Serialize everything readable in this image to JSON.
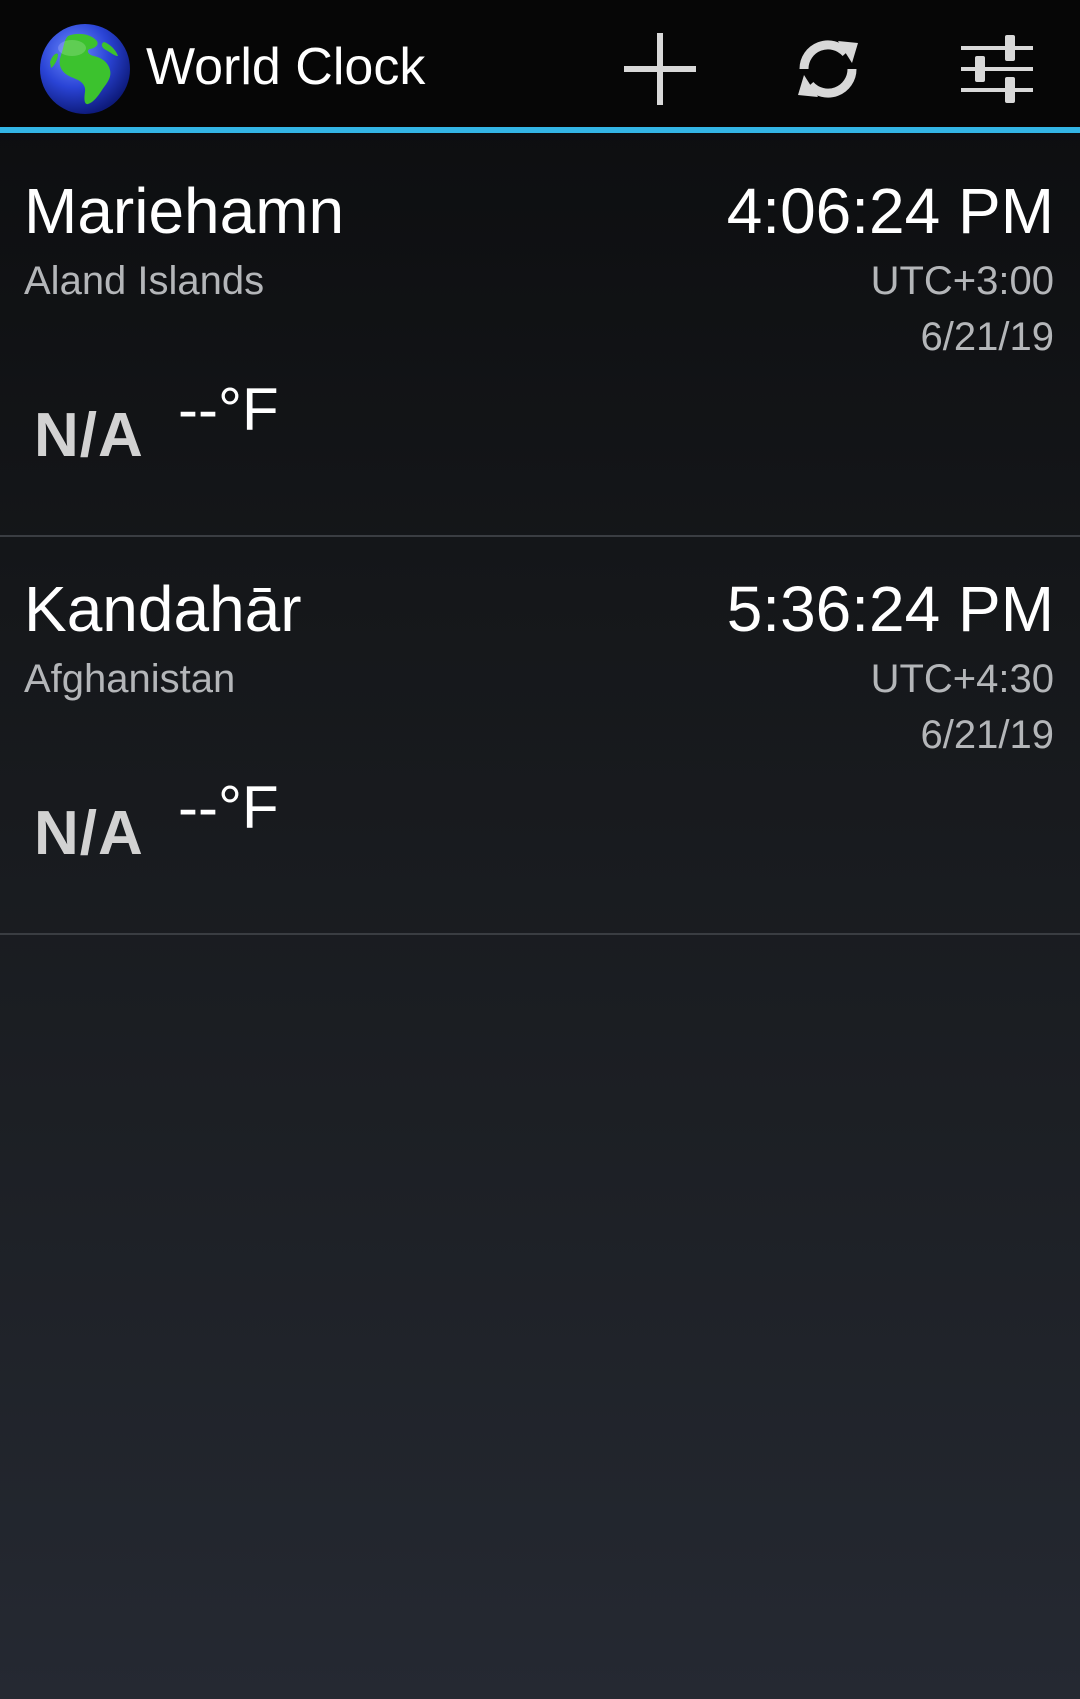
{
  "action_bar": {
    "title": "World Clock",
    "icons": {
      "app": "globe-icon",
      "add": "plus-icon",
      "refresh": "refresh-icon",
      "settings": "sliders-icon"
    },
    "accent_color": "#33b5e5"
  },
  "clocks": [
    {
      "city": "Mariehamn",
      "country": "Aland Islands",
      "time": "4:06:24 PM",
      "utc_offset": "UTC+3:00",
      "date": "6/21/19",
      "weather_icon_text": "N/A",
      "temperature": "--°F"
    },
    {
      "city": "Kandahār",
      "country": "Afghanistan",
      "time": "5:36:24 PM",
      "utc_offset": "UTC+4:30",
      "date": "6/21/19",
      "weather_icon_text": "N/A",
      "temperature": "--°F"
    }
  ]
}
